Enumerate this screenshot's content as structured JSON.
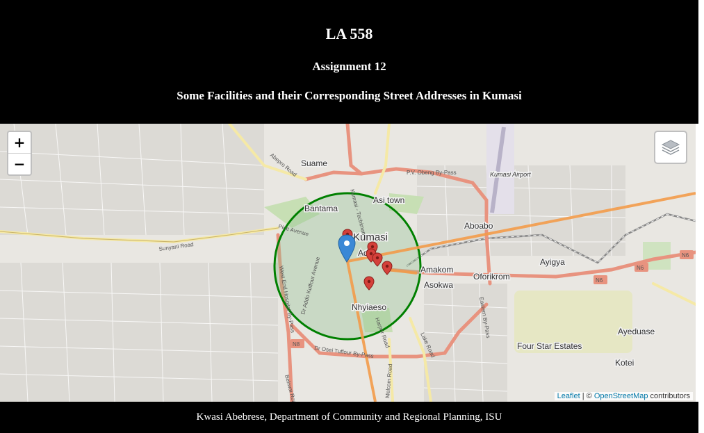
{
  "header": {
    "title": "LA 558",
    "subtitle": "Assignment 12",
    "heading": "Some Facilities and their Corresponding Street Addresses in Kumasi"
  },
  "map": {
    "zoom_in_label": "+",
    "zoom_out_label": "−",
    "layers_icon": "layers-icon",
    "place_labels": {
      "suame": "Suame",
      "bantama": "Bantama",
      "asi_town": "Asi town",
      "kumasi": "Kumasi",
      "adum": "Adu",
      "aboabo": "Aboabo",
      "ayigya": "Ayigya",
      "amakom": "Amakom",
      "asokwa": "Asokwa",
      "oforikrom": "Oforikrom",
      "nhyiaeso": "Nhyiaeso",
      "four_star": "Four Star Estates",
      "ayeduase": "Ayeduase",
      "kotei": "Kotei",
      "airport": "Kumasi Airport"
    },
    "road_labels": {
      "pv_obeng": "P.V. Obeng By-Pass",
      "sunyani": "Sunyani Road",
      "abepro": "Abepro Road",
      "pine": "Pine Avenue",
      "west_end": "West End Hospital By-Pass",
      "addo": "Dr Addo Kuffour Avenue",
      "osei": "Dr Osei Tuffour By-Pass",
      "lake": "Lake Road",
      "eastern": "Eastern By-Pass",
      "harper": "Harper Road",
      "melcom": "Melcom Road",
      "bekwai": "Bekwai Road",
      "techiman": "Kumasi - Techiman",
      "n6a": "N6",
      "n6b": "N6",
      "n6c": "N6",
      "n8": "N8"
    },
    "attribution": {
      "leaflet": "Leaflet",
      "separator": " | © ",
      "osm": "OpenStreetMap",
      "suffix": " contributors"
    },
    "colors": {
      "circle": "#008000",
      "circle_fill": "#8fbf8f",
      "lines": "#f39b4a",
      "marker_blue": "#3a88d6",
      "marker_red": "#d4403a"
    }
  },
  "footer": {
    "credit": "Kwasi Abebrese, Department of Community and Regional Planning, ISU"
  }
}
